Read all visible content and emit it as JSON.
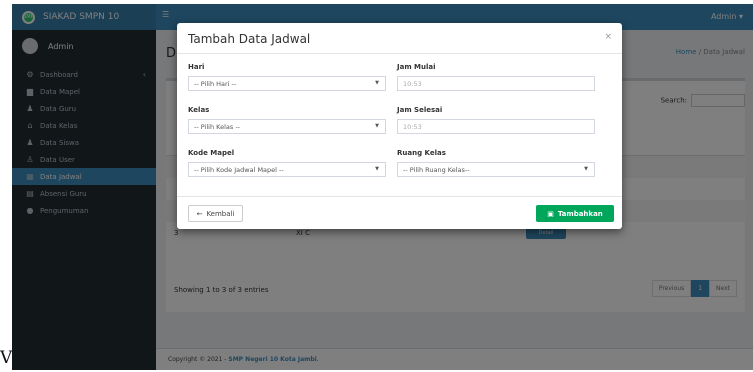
{
  "brand": {
    "logo_text": "SMP",
    "name": "SIAKAD SMPN 10"
  },
  "user": {
    "name": "Admin"
  },
  "menu": [
    {
      "icon": "dashboard-icon",
      "glyph": "⚙",
      "label": "Dashboard"
    },
    {
      "icon": "book-icon",
      "glyph": "▆",
      "label": "Data Mapel"
    },
    {
      "icon": "users-icon",
      "glyph": "♟",
      "label": "Data Guru"
    },
    {
      "icon": "home-icon",
      "glyph": "⌂",
      "label": "Data Kelas"
    },
    {
      "icon": "users-icon",
      "glyph": "♟",
      "label": "Data Siswa"
    },
    {
      "icon": "user-plus-icon",
      "glyph": "♙",
      "label": "Data User"
    },
    {
      "icon": "calendar-icon",
      "glyph": "▦",
      "label": "Data Jadwal"
    },
    {
      "icon": "clipboard-icon",
      "glyph": "▤",
      "label": "Absensi Guru"
    },
    {
      "icon": "info-icon",
      "glyph": "●",
      "label": "Pengumuman"
    }
  ],
  "header": {
    "admin_label": "Admin ▾"
  },
  "content": {
    "title_initial": "D",
    "breadcrumb": {
      "home": "Home",
      "sep": "/",
      "current": "Data Jadwal"
    },
    "search_label": "Search:",
    "table_row": {
      "no": "3",
      "kelas": "XI C",
      "action": "Detail"
    },
    "showing": "Showing 1 to 3 of 3 entries",
    "pagination": {
      "prev": "Previous",
      "page": "1",
      "next": "Next"
    }
  },
  "footer": {
    "prefix": "Copyright © 2021 - ",
    "org": "SMP Negeri 10 Kota Jambi",
    "suffix": "."
  },
  "modal": {
    "title": "Tambah Data Jadwal",
    "close": "×",
    "fields": {
      "hari": {
        "label": "Hari",
        "value": "-- Pilih Hari --"
      },
      "jam_mulai": {
        "label": "Jam Mulai",
        "placeholder": "10:53"
      },
      "kelas": {
        "label": "Kelas",
        "value": "-- Pilih Kelas --"
      },
      "jam_selesai": {
        "label": "Jam Selesai",
        "placeholder": "10:53"
      },
      "kode_mapel": {
        "label": "Kode Mapel",
        "value": "-- Pilih Kode Jadwal Mapel --"
      },
      "ruang_kelas": {
        "label": "Ruang Kelas",
        "value": "-- Pilih Ruang Kelas--"
      }
    },
    "back_label": "Kembali",
    "submit_label": "Tambahkan"
  },
  "stray_text": "V",
  "colors": {
    "primary": "#3c8dbc",
    "sidebar": "#222d32",
    "success": "#00a65a"
  }
}
